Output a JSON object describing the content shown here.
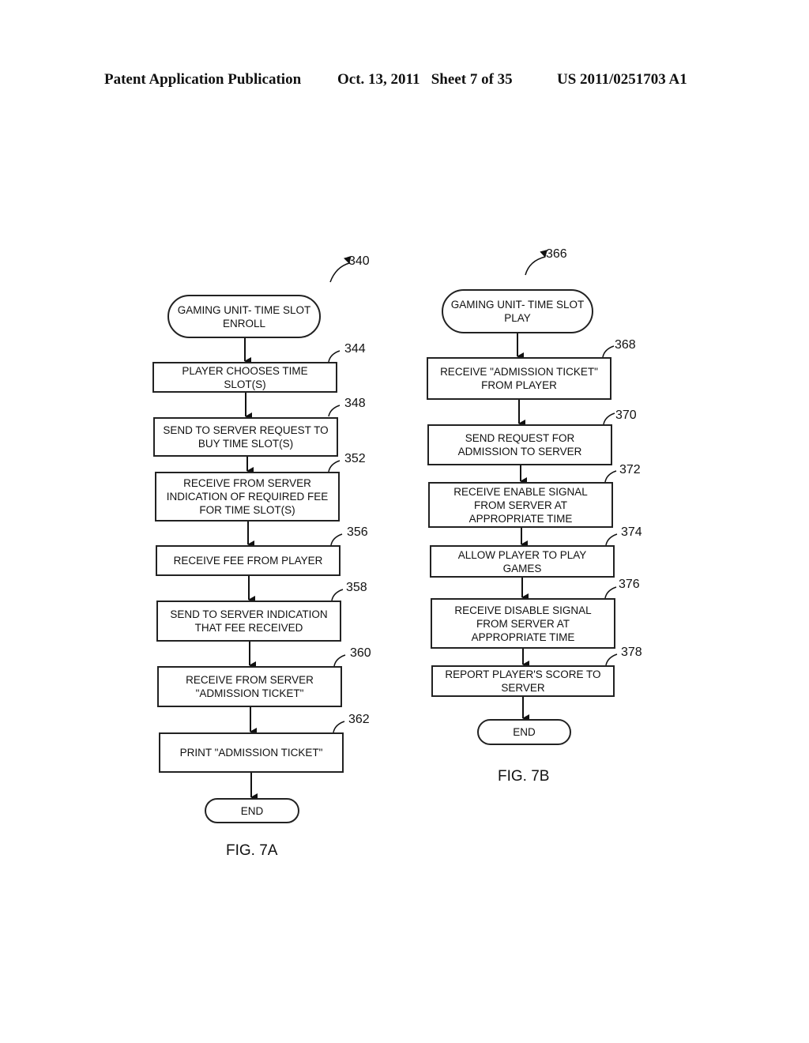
{
  "header": {
    "publication": "Patent Application Publication",
    "date_sheet": "Oct. 13, 2011   Sheet 7 of 35",
    "number": "US 2011/0251703 A1"
  },
  "fig7a": {
    "ref": "340",
    "start": "GAMING UNIT- TIME SLOT\nENROLL",
    "steps": [
      {
        "ref": "344",
        "text": "PLAYER CHOOSES TIME\nSLOT(S)"
      },
      {
        "ref": "348",
        "text": "SEND TO SERVER REQUEST TO\nBUY TIME SLOT(S)"
      },
      {
        "ref": "352",
        "text": "RECEIVE FROM SERVER\nINDICATION OF REQUIRED FEE\nFOR TIME SLOT(S)"
      },
      {
        "ref": "356",
        "text": "RECEIVE FEE FROM PLAYER"
      },
      {
        "ref": "358",
        "text": "SEND TO SERVER INDICATION\nTHAT FEE RECEIVED"
      },
      {
        "ref": "360",
        "text": "RECEIVE FROM SERVER\n\"ADMISSION TICKET\""
      },
      {
        "ref": "362",
        "text": "PRINT \"ADMISSION TICKET\""
      }
    ],
    "end": "END",
    "caption": "FIG. 7A"
  },
  "fig7b": {
    "ref": "366",
    "start": "GAMING UNIT- TIME SLOT\nPLAY",
    "steps": [
      {
        "ref": "368",
        "text": "RECEIVE \"ADMISSION TICKET\"\nFROM PLAYER"
      },
      {
        "ref": "370",
        "text": "SEND REQUEST FOR\nADMISSION TO SERVER"
      },
      {
        "ref": "372",
        "text": "RECEIVE ENABLE SIGNAL\nFROM SERVER AT\nAPPROPRIATE TIME"
      },
      {
        "ref": "374",
        "text": "ALLOW PLAYER TO PLAY\nGAMES"
      },
      {
        "ref": "376",
        "text": "RECEIVE DISABLE SIGNAL\nFROM SERVER AT\nAPPROPRIATE TIME"
      },
      {
        "ref": "378",
        "text": "REPORT PLAYER'S SCORE TO\nSERVER"
      }
    ],
    "end": "END",
    "caption": "FIG. 7B"
  }
}
